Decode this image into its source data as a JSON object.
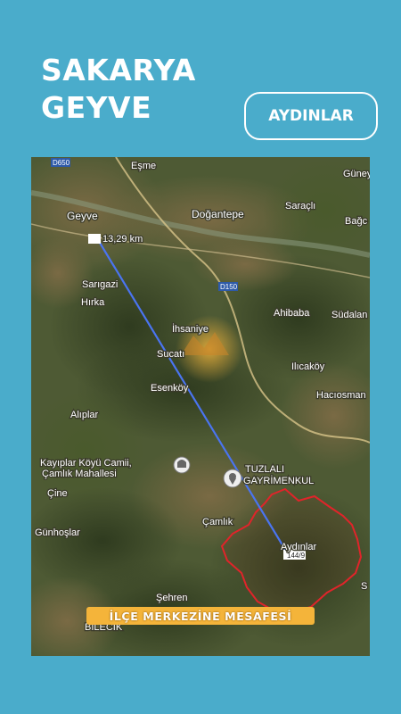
{
  "header": {
    "title_line1": "SAKARYA",
    "title_line2": "GEYVE",
    "button_label": "AYDINLAR"
  },
  "map": {
    "distance_label": "13,29 km",
    "road_labels": [
      "D650",
      "D150"
    ],
    "route_badge": "144/9",
    "places": [
      "Eşme",
      "Güney",
      "Geyve",
      "Doğantepe",
      "Saraçlı",
      "Bağc",
      "Sarıgazi",
      "Hırka",
      "Ahibaba",
      "Südalan",
      "İhsaniye",
      "Sucatı",
      "Ilıcaköy",
      "Esenköy",
      "Hacıosman",
      "Alıplar",
      "Kayıplar Köyü Camii,",
      "Çamlık Mahallesi",
      "TUZLALI",
      "GAYRİMENKUL",
      "Çine",
      "Çamlık",
      "Günhoşlar",
      "Aydınlar",
      "Şehren",
      "BİLECİK",
      "S"
    ],
    "line_color": "#4a74f0",
    "boundary_color": "#e0242a"
  },
  "caption": "İLÇE MERKEZİNE MESAFESİ"
}
